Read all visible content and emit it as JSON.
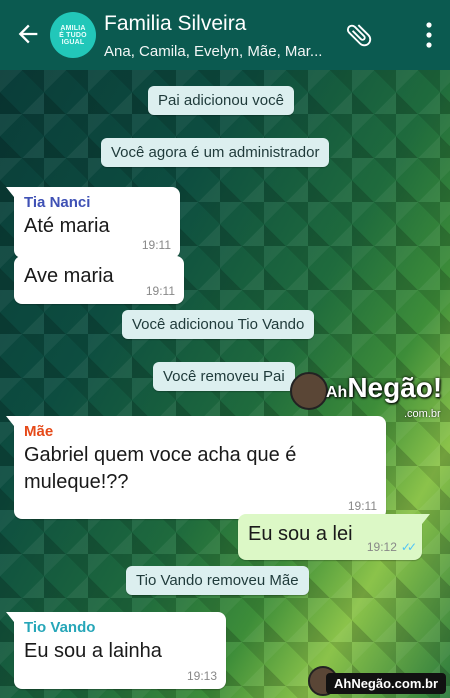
{
  "header": {
    "title": "Familia Silveira",
    "subtitle": "Ana, Camila, Evelyn, Mãe, Mar...",
    "avatar_line1": "AMILIA",
    "avatar_line2": "É TUDO",
    "avatar_line3": "IGUAL"
  },
  "system_messages": [
    "Pai adicionou você",
    "Você agora é um administrador",
    "Você adicionou Tio Vando",
    "Você removeu Pai",
    "Tio Vando removeu Mãe"
  ],
  "messages": [
    {
      "sender": "Tia Nanci",
      "sender_color": "#3f51b5",
      "text": "Até maria",
      "time": "19:11"
    },
    {
      "text": "Ave maria",
      "time": "19:11"
    },
    {
      "sender": "Mãe",
      "sender_color": "#e64a19",
      "text": "Gabriel quem voce acha que é muleque!??",
      "time": "19:11"
    },
    {
      "text": "Eu sou a lei",
      "time": "19:12",
      "outgoing": true
    },
    {
      "sender": "Tio Vando",
      "sender_color": "#26a6b8",
      "text": "Eu sou a lainha",
      "time": "19:13"
    }
  ],
  "watermark": {
    "brand_prefix": "Ah",
    "brand_main": "Negão!",
    "brand_sub": ".com.br",
    "footer": "AhNegão.com.br"
  },
  "icons": {
    "back": "arrow-left-icon",
    "attach": "paperclip-icon",
    "menu": "more-vertical-icon",
    "read": "double-check-icon"
  },
  "colors": {
    "header": "#0b5a50",
    "incoming_bubble": "#ffffff",
    "outgoing_bubble": "#dcf8c6",
    "system_bubble": "#dcefef",
    "read_ticks": "#4fc3f7"
  }
}
